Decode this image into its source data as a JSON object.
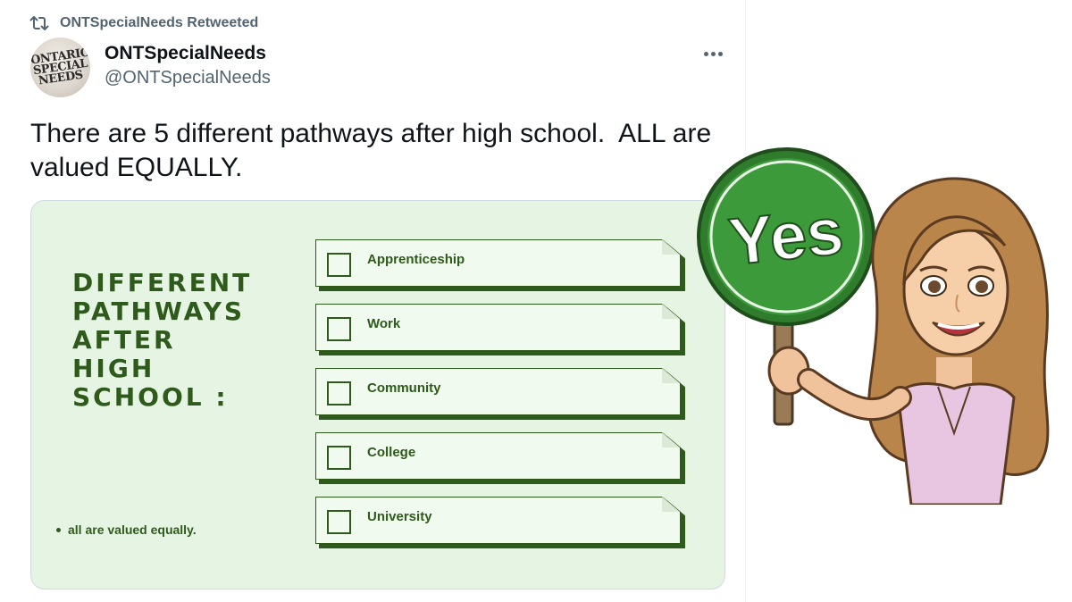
{
  "retweet_banner": {
    "text": "ONTSpecialNeeds Retweeted",
    "icon": "retweet-icon"
  },
  "author": {
    "display_name": "ONTSpecialNeeds",
    "handle": "@ONTSpecialNeeds",
    "avatar_text": [
      "ONTARIO",
      "SPECIAL",
      "NEEDS"
    ]
  },
  "tweet": {
    "text": "There are 5 different pathways after high school.  ALL are valued EQUALLY."
  },
  "more_menu": {
    "icon": "more-horizontal-icon"
  },
  "media": {
    "heading_lines": [
      "DIFFERENT",
      "PATHWAYS",
      "AFTER",
      "HIGH",
      "SCHOOL :"
    ],
    "pathways": [
      "Apprenticeship",
      "Work",
      "Community",
      "College",
      "University"
    ],
    "footnote": "all are valued equally."
  },
  "sticker": {
    "sign_text": "Yes",
    "description_icon": "bitmoji-yes-sign-icon"
  },
  "colors": {
    "card_background": "#e6f5e3",
    "card_green": "#2e5a1c",
    "sign_green": "#3c9a3a",
    "muted_text": "#536471"
  }
}
